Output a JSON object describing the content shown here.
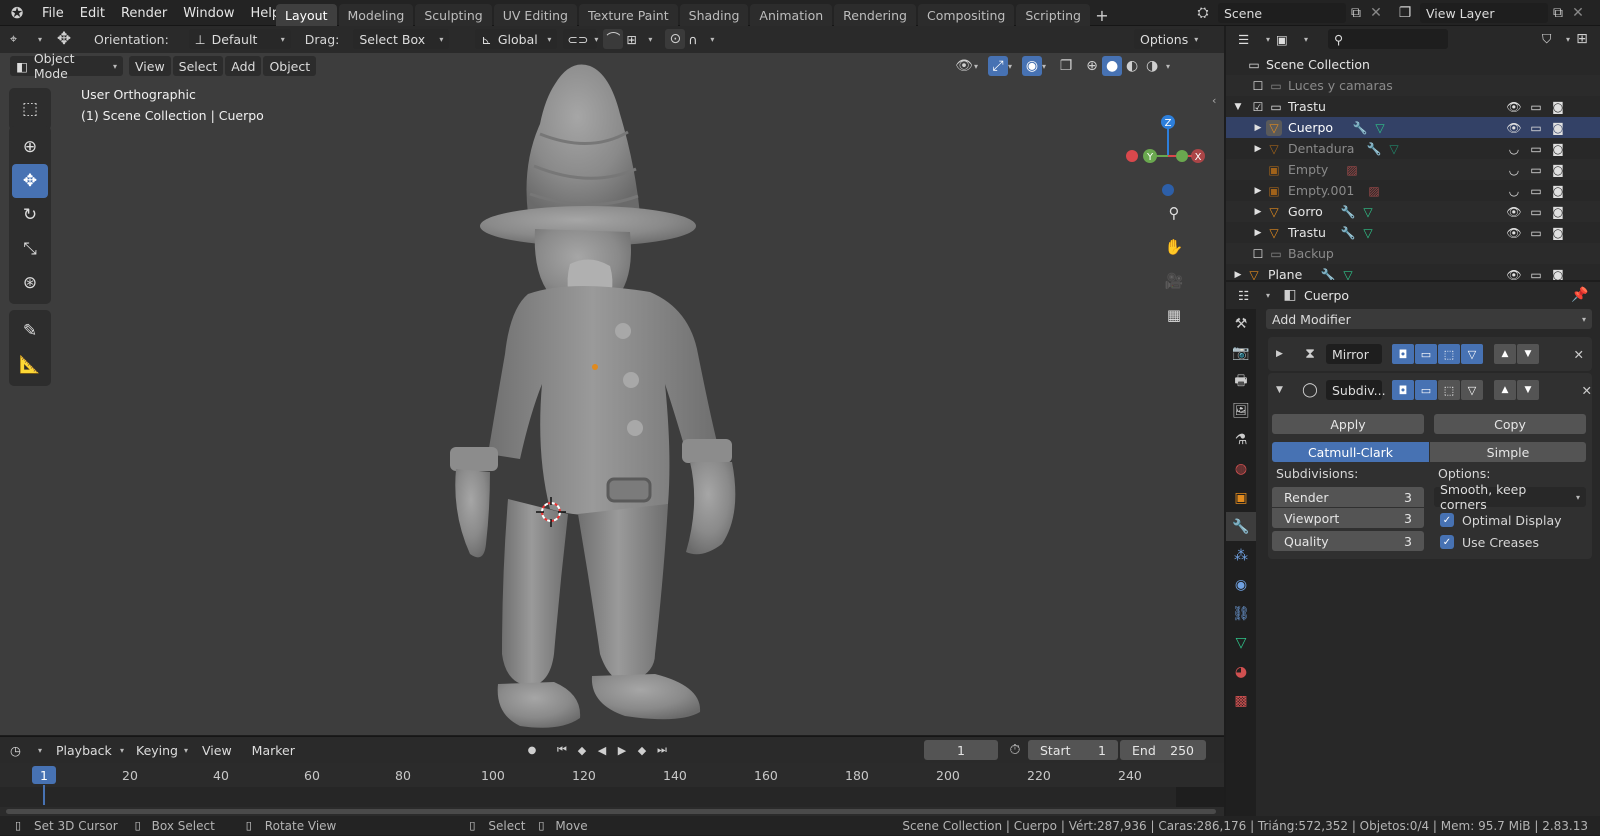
{
  "menu": {
    "items": [
      "File",
      "Edit",
      "Render",
      "Window",
      "Help"
    ]
  },
  "workspaces": [
    "Layout",
    "Modeling",
    "Sculpting",
    "UV Editing",
    "Texture Paint",
    "Shading",
    "Animation",
    "Rendering",
    "Compositing",
    "Scripting"
  ],
  "active_workspace": "Layout",
  "scene": {
    "name": "Scene",
    "view_layer": "View Layer"
  },
  "tool_header": {
    "orientation_label": "Orientation:",
    "orientation_value": "Default",
    "drag_label": "Drag:",
    "drag_value": "Select Box",
    "transform_orientation": "Global",
    "options_label": "Options"
  },
  "viewport_header": {
    "mode": "Object Mode",
    "menus": [
      "View",
      "Select",
      "Add",
      "Object"
    ]
  },
  "viewport": {
    "view_name": "User Orthographic",
    "collection_info": "(1) Scene Collection | Cuerpo"
  },
  "gizmo": {
    "z": "Z",
    "y": "Y",
    "x": "X"
  },
  "outliner": {
    "root": "Scene Collection",
    "rows": [
      {
        "name": "Luces y camaras",
        "dim": true
      },
      {
        "name": "Trastu",
        "dim": false
      },
      {
        "name": "Cuerpo",
        "dim": false
      },
      {
        "name": "Dentadura",
        "dim": true
      },
      {
        "name": "Empty",
        "dim": true
      },
      {
        "name": "Empty.001",
        "dim": true
      },
      {
        "name": "Gorro",
        "dim": false
      },
      {
        "name": "Trastu",
        "dim": false
      },
      {
        "name": "Backup",
        "dim": true
      },
      {
        "name": "Plane",
        "dim": false
      }
    ]
  },
  "properties": {
    "object_name": "Cuerpo",
    "add_modifier": "Add Modifier",
    "modifiers": [
      {
        "name": "Mirror"
      },
      {
        "name": "Subdiv..."
      }
    ],
    "apply_label": "Apply",
    "copy_label": "Copy",
    "algorithm": {
      "options": [
        "Catmull-Clark",
        "Simple"
      ],
      "selected": "Catmull-Clark"
    },
    "subdivisions_label": "Subdivisions:",
    "options_label": "Options:",
    "fields": [
      {
        "label": "Render",
        "value": "3"
      },
      {
        "label": "Viewport",
        "value": "3"
      },
      {
        "label": "Quality",
        "value": "3"
      }
    ],
    "uv_smooth": "Smooth, keep corners",
    "checks": [
      {
        "label": "Optimal Display",
        "checked": true
      },
      {
        "label": "Use Creases",
        "checked": true
      }
    ]
  },
  "timeline": {
    "menus": [
      "Playback",
      "Keying",
      "View",
      "Marker"
    ],
    "current_frame": "1",
    "start_label": "Start",
    "start": "1",
    "end_label": "End",
    "end": "250",
    "ruler_ticks": [
      "20",
      "40",
      "60",
      "80",
      "100",
      "120",
      "140",
      "160",
      "180",
      "200",
      "220",
      "240"
    ],
    "playhead": "1"
  },
  "statusbar": {
    "hints": [
      "Set 3D Cursor",
      "Box Select",
      "Rotate View",
      "Select",
      "Move"
    ],
    "info": "Scene Collection | Cuerpo | Vért:287,936 | Caras:286,176 | Triáng:572,352 | Objetos:0/4 | Mem: 95.7 MiB | 2.83.13"
  },
  "colors": {
    "accent": "#4772b3",
    "viewport_bg": "#3d3d3d",
    "panel_bg": "#282828",
    "origin": "#e08a1e"
  }
}
